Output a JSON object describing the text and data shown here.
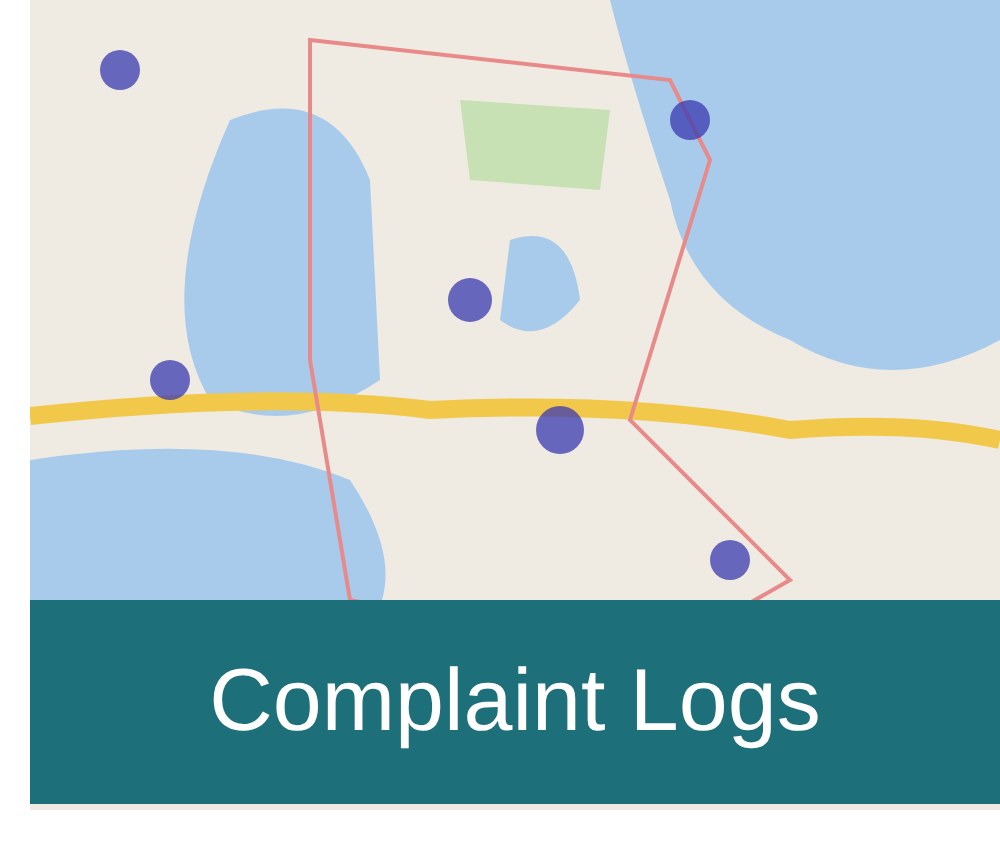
{
  "banner": {
    "title": "Complaint Logs"
  }
}
